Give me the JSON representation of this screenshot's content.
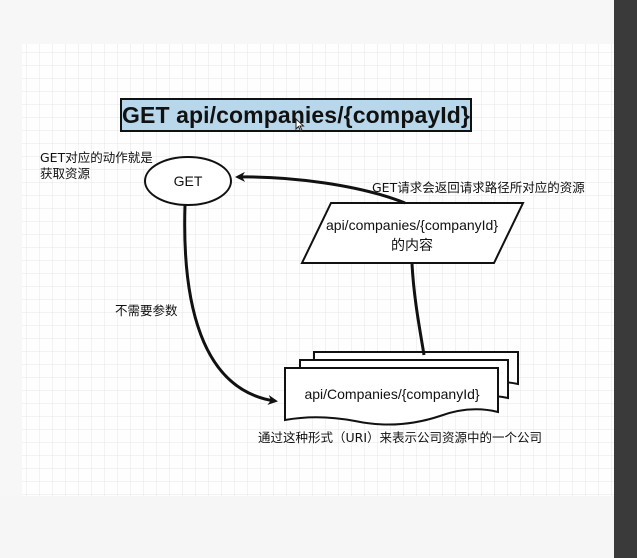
{
  "title": "GET api/companies/{compayId}",
  "nodes": {
    "get_ellipse": "GET",
    "parallelogram_line1": "api/companies/{companyId}",
    "parallelogram_line2": "的内容",
    "document": "api/Companies/{companyId}"
  },
  "labels": {
    "get_action_line1": "GET对应的动作就是",
    "get_action_line2": "获取资源",
    "returns_content": "GET请求会返回请求路径所对应的资源",
    "no_params": "不需要参数",
    "uri_meaning": "通过这种形式（URI）来表示公司资源中的一个公司"
  },
  "colors": {
    "title_fill": "#b9d7ea",
    "stroke": "#111111",
    "grid": "#e9e9e9"
  }
}
